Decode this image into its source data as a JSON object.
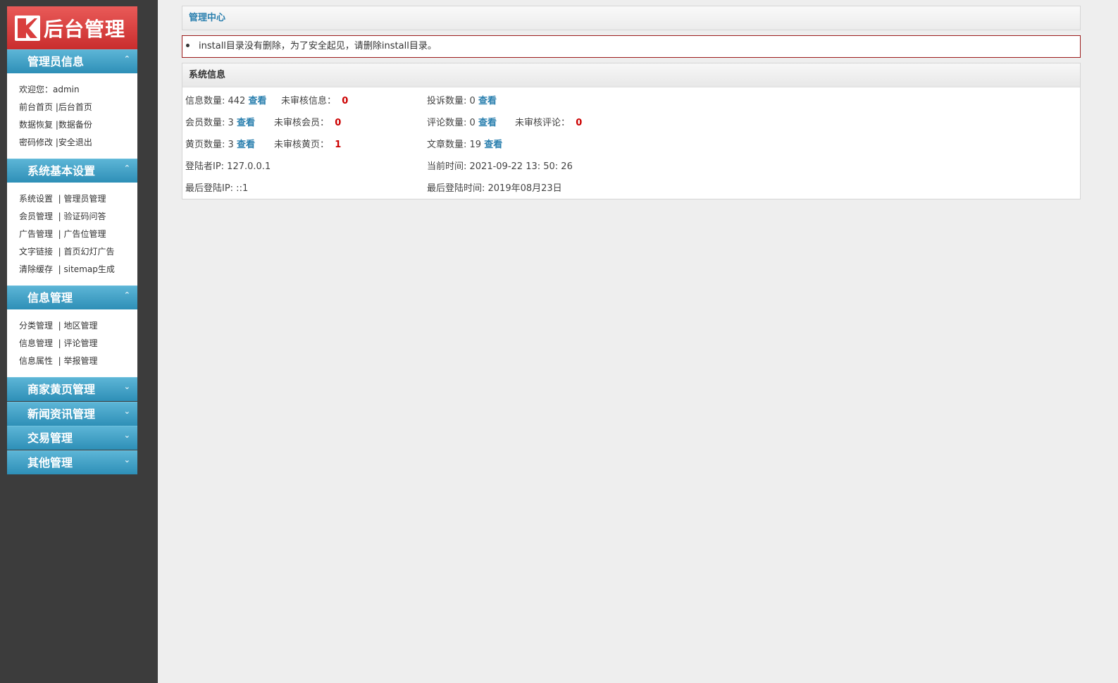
{
  "logo": {
    "text": "后台管理"
  },
  "sidebar": {
    "sections": [
      {
        "title": "管理员信息",
        "arrow": "⌃",
        "rows": [
          [
            "欢迎您：admin"
          ],
          [
            "前台首页",
            "|后台首页"
          ],
          [
            "数据恢复",
            "|数据备份"
          ],
          [
            "密码修改",
            "|安全退出"
          ]
        ]
      },
      {
        "title": "系统基本设置",
        "arrow": "⌃",
        "rows": [
          [
            "系统设置",
            "| 管理员管理"
          ],
          [
            "会员管理",
            "| 验证码问答"
          ],
          [
            "广告管理",
            "| 广告位管理"
          ],
          [
            "文字链接",
            "| 首页幻灯广告"
          ],
          [
            "清除缓存",
            "| sitemap生成"
          ]
        ]
      },
      {
        "title": "信息管理",
        "arrow": "⌃",
        "rows": [
          [
            "分类管理",
            "| 地区管理"
          ],
          [
            "信息管理",
            "| 评论管理"
          ],
          [
            "信息属性",
            "| 举报管理"
          ]
        ]
      },
      {
        "title": "商家黄页管理",
        "arrow": "⌄"
      },
      {
        "title": "新闻资讯管理",
        "arrow": "⌄"
      },
      {
        "title": "交易管理",
        "arrow": "⌄"
      },
      {
        "title": "其他管理",
        "arrow": "⌄"
      }
    ]
  },
  "main": {
    "title": "管理中心",
    "alert": "install目录没有删除，为了安全起见，请删除install目录。",
    "sys_title": "系统信息",
    "view": "查看",
    "info_count_label": "信息数量: 442",
    "unreviewed_info_label": "未审核信息：",
    "unreviewed_info": "0",
    "complaint_label": "投诉数量: 0",
    "member_label": "会员数量: 3",
    "unreviewed_member_label": "未审核会员：",
    "unreviewed_member": "0",
    "comment_label": "评论数量: 0",
    "unreviewed_comment_label": "未审核评论：",
    "unreviewed_comment": "0",
    "yellow_label": "黄页数量: 3",
    "unreviewed_yellow_label": "未审核黄页：",
    "unreviewed_yellow": "1",
    "article_label": "文章数量: 19",
    "login_ip": "登陆者IP: 127.0.0.1",
    "current_time": "当前时间: 2021-09-22 13: 50: 26",
    "last_ip": "最后登陆IP: ::1",
    "last_time": "最后登陆时间: 2019年08月23日"
  },
  "colors": {
    "accent": "#2a7fae",
    "alert_border": "#9b1c1c",
    "logo_red": "#d93e3d",
    "sidebar_bg": "#3c3c3c"
  }
}
